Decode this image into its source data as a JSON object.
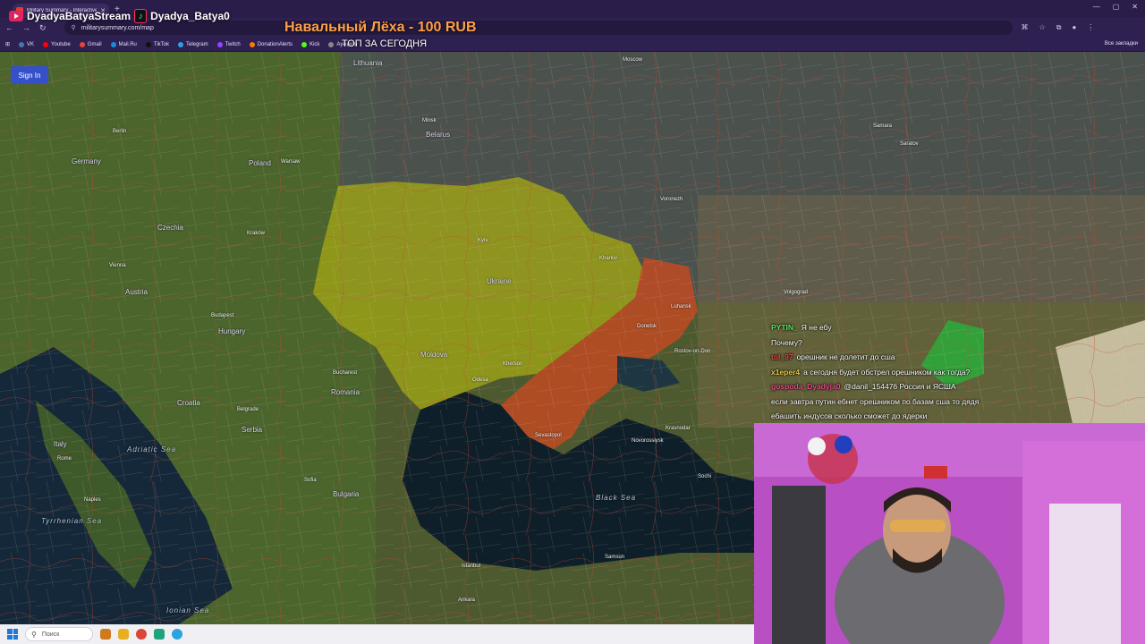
{
  "browser": {
    "tab_title": "Military Summary - Interactive...",
    "url": "militarysummary.com/map",
    "bookmarks": [
      "VK",
      "Youtube",
      "Gmail",
      "Mail.Ru",
      "TikTok",
      "Telegram",
      "Twitch",
      "DonationAlerts",
      "Kick",
      "Аукцион"
    ],
    "bookmark_colors": [
      "#4a76a8",
      "#ff0000",
      "#ea4335",
      "#168de2",
      "#111111",
      "#2aa3df",
      "#9146ff",
      "#f57d07",
      "#53fc18",
      "#888888"
    ],
    "all_bookmarks": "Все закладки"
  },
  "overlay": {
    "channel_youtube": "DyadyaBatyaStream",
    "channel_tiktok": "Dyadya_Batya0",
    "donation": "Навальный Лёха - 100 RUB",
    "top_today": "ТОП ЗА СЕГОДНЯ"
  },
  "map": {
    "signin_label": "Sign In",
    "labels": [
      {
        "text": "Moscow"
      },
      {
        "text": "Minsk"
      },
      {
        "text": "Belarus"
      },
      {
        "text": "Lithuania"
      },
      {
        "text": "Warsaw"
      },
      {
        "text": "Poland"
      },
      {
        "text": "Germany"
      },
      {
        "text": "Berlin"
      },
      {
        "text": "Kraków"
      },
      {
        "text": "Czechia"
      },
      {
        "text": "Vienna"
      },
      {
        "text": "Austria"
      },
      {
        "text": "Budapest"
      },
      {
        "text": "Hungary"
      },
      {
        "text": "Ukraine"
      },
      {
        "text": "Kyiv"
      },
      {
        "text": "Kharkiv"
      },
      {
        "text": "Voronezh"
      },
      {
        "text": "Volgograd"
      },
      {
        "text": "Saratov"
      },
      {
        "text": "Samara"
      },
      {
        "text": "Romania"
      },
      {
        "text": "Bucharest"
      },
      {
        "text": "Moldova"
      },
      {
        "text": "Odesa"
      },
      {
        "text": "Kherson"
      },
      {
        "text": "Donetsk"
      },
      {
        "text": "Luhansk"
      },
      {
        "text": "Rostov-on-Don"
      },
      {
        "text": "Krasnodar"
      },
      {
        "text": "Sevastopol"
      },
      {
        "text": "Novorossiysk"
      },
      {
        "text": "Serbia"
      },
      {
        "text": "Belgrade"
      },
      {
        "text": "Bulgaria"
      },
      {
        "text": "Sofia"
      },
      {
        "text": "Italy"
      },
      {
        "text": "Rome"
      },
      {
        "text": "Naples"
      },
      {
        "text": "Croatia"
      },
      {
        "text": "Black Sea"
      },
      {
        "text": "Adriatic Sea"
      },
      {
        "text": "Tyrrhenian Sea"
      },
      {
        "text": "Ionian Sea"
      },
      {
        "text": "Ankara"
      },
      {
        "text": "Samsun"
      },
      {
        "text": "Istanbul"
      },
      {
        "text": "Sochi"
      }
    ]
  },
  "chat": [
    {
      "nick": "PYTIN_",
      "color": "#5be35b",
      "msg": "Я не ебу"
    },
    {
      "nick": "",
      "color": "#44c744",
      "msg": "Почему?"
    },
    {
      "nick": "tol_97",
      "color": "#e34848",
      "msg": "орешник не долетит до сша"
    },
    {
      "nick": "x1eper4",
      "color": "#e6c84a",
      "msg": "а сегодня будет обстрел орешником как тогда?"
    },
    {
      "nick": "gospoda_Dyadyja0",
      "color": "#e84d8a",
      "msg": "@danil_154476 Россия и ЯСША"
    },
    {
      "nick": "",
      "color": "#8a8aff",
      "msg": "если завтра путин ебнет орешником по базам сша то дядя"
    },
    {
      "nick": "",
      "color": "#ffffff",
      "msg": "ебашить индусов сколько сможет до ядерки"
    }
  ],
  "taskbar": {
    "search_placeholder": "Поиск"
  }
}
